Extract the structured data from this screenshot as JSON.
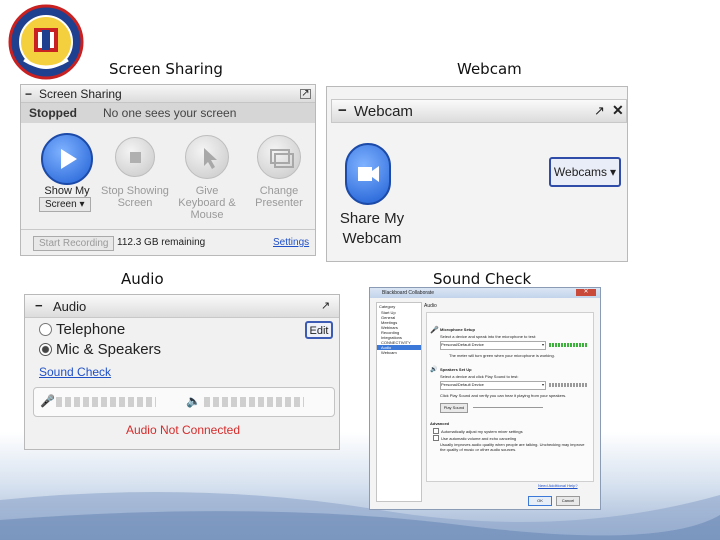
{
  "captions": {
    "screen_sharing": "Screen Sharing",
    "webcam": "Webcam",
    "audio": "Audio",
    "sound_check": "Sound Check"
  },
  "screen_sharing": {
    "title": "Screen Sharing",
    "status": "Stopped",
    "status_message": "No one sees your screen",
    "buttons": {
      "show_my": "Show My",
      "screen_dropdown": "Screen",
      "stop_showing": "Stop Showing Screen",
      "give_control": "Give Keyboard & Mouse",
      "change_presenter": "Change Presenter"
    },
    "start_recording": "Start Recording",
    "remaining": "112.3 GB remaining",
    "settings": "Settings"
  },
  "webcam": {
    "title": "Webcam",
    "share_label": "Share My Webcam",
    "dropdown": "Webcams"
  },
  "audio": {
    "title": "Audio",
    "edit": "Edit",
    "options": [
      "Telephone",
      "Mic & Speakers"
    ],
    "selected": "Mic & Speakers",
    "sound_check": "Sound Check",
    "status": "Audio Not Connected"
  },
  "sound_check": {
    "window_title": "Blackboard Collaborate",
    "category_header": "Category",
    "categories": [
      "Start Up",
      "General",
      "Meetings",
      "Webinars",
      "Recording",
      "Integrations",
      "CONNECTIVITY",
      "Audio",
      "Webcam"
    ],
    "selected_category": "Audio",
    "panel_title": "Audio",
    "mic_header": "Microphone Setup",
    "mic_instruction": "Select a device and speak into the microphone to test:",
    "mic_device": "Personal/Default Device",
    "mic_note": "The meter will turn green when your microphone is working.",
    "speaker_header": "Speakers Set Up",
    "speaker_instruction": "Select a device and click Play Sound to test:",
    "speaker_device": "Personal/Default Device",
    "speaker_note": "Click Play Sound and verify you can hear it playing from your speakers.",
    "play_sound": "Play Sound",
    "advanced_header": "Advanced",
    "advanced_options": [
      "Automatically adjust my system mixer settings",
      "Use automatic volume and echo canceling"
    ],
    "advanced_note": "Usually improves audio quality when people are talking. Unchecking may improve the quality of music or other audio sources.",
    "need_help": "Need Additional Help?",
    "ok": "OK",
    "cancel": "Cancel"
  }
}
